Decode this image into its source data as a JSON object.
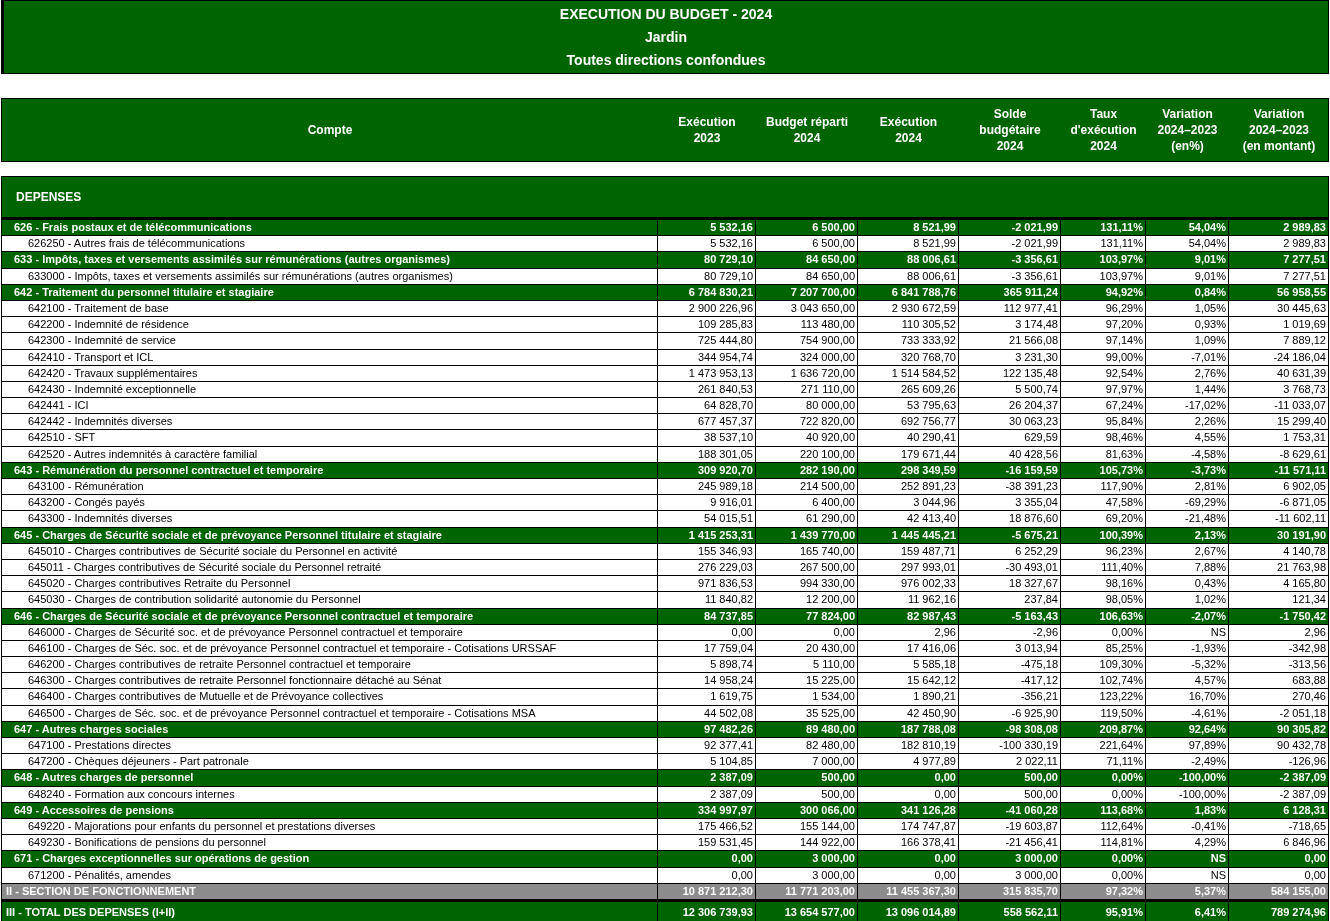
{
  "report": {
    "title": "EXECUTION DU BUDGET - 2024",
    "subtitle": "Jardin",
    "scope": "Toutes directions confondues"
  },
  "table": {
    "columns": [
      [
        "Compte"
      ],
      [
        "Exécution",
        "2023"
      ],
      [
        "Budget réparti",
        "2024"
      ],
      [
        "Exécution",
        "2024"
      ],
      [
        "Solde",
        "budgétaire",
        "2024"
      ],
      [
        "Taux",
        "d'exécution",
        "2024"
      ],
      [
        "Variation",
        "2024–2023",
        "(en%)"
      ],
      [
        "Variation",
        "2024–2023",
        "(en montant)"
      ]
    ],
    "section_title": "DEPENSES",
    "rows": [
      {
        "kind": "group",
        "label": "626 - Frais postaux et de télécommunications",
        "values": [
          "5 532,16",
          "6 500,00",
          "8 521,99",
          "-2 021,99",
          "131,11%",
          "54,04%",
          "2 989,83"
        ]
      },
      {
        "kind": "item",
        "label": "626250 - Autres frais de télécommunications",
        "values": [
          "5 532,16",
          "6 500,00",
          "8 521,99",
          "-2 021,99",
          "131,11%",
          "54,04%",
          "2 989,83"
        ]
      },
      {
        "kind": "group",
        "label": "633 - Impôts, taxes et versements assimilés sur rémunérations (autres organismes)",
        "values": [
          "80 729,10",
          "84 650,00",
          "88 006,61",
          "-3 356,61",
          "103,97%",
          "9,01%",
          "7 277,51"
        ]
      },
      {
        "kind": "item",
        "label": "633000 - Impôts, taxes et versements assimilés sur rémunérations (autres organismes)",
        "values": [
          "80 729,10",
          "84 650,00",
          "88 006,61",
          "-3 356,61",
          "103,97%",
          "9,01%",
          "7 277,51"
        ]
      },
      {
        "kind": "group",
        "label": "642 - Traitement du personnel titulaire et stagiaire",
        "values": [
          "6 784 830,21",
          "7 207 700,00",
          "6 841 788,76",
          "365 911,24",
          "94,92%",
          "0,84%",
          "56 958,55"
        ]
      },
      {
        "kind": "item",
        "label": "642100 - Traitement de base",
        "values": [
          "2 900 226,96",
          "3 043 650,00",
          "2 930 672,59",
          "112 977,41",
          "96,29%",
          "1,05%",
          "30 445,63"
        ]
      },
      {
        "kind": "item",
        "label": "642200 - Indemnité de résidence",
        "values": [
          "109 285,83",
          "113 480,00",
          "110 305,52",
          "3 174,48",
          "97,20%",
          "0,93%",
          "1 019,69"
        ]
      },
      {
        "kind": "item",
        "label": "642300 - Indemnité de service",
        "values": [
          "725 444,80",
          "754 900,00",
          "733 333,92",
          "21 566,08",
          "97,14%",
          "1,09%",
          "7 889,12"
        ]
      },
      {
        "kind": "item",
        "label": "642410 - Transport et ICL",
        "values": [
          "344 954,74",
          "324 000,00",
          "320 768,70",
          "3 231,30",
          "99,00%",
          "-7,01%",
          "-24 186,04"
        ]
      },
      {
        "kind": "item",
        "label": "642420 - Travaux supplémentaires",
        "values": [
          "1 473 953,13",
          "1 636 720,00",
          "1 514 584,52",
          "122 135,48",
          "92,54%",
          "2,76%",
          "40 631,39"
        ]
      },
      {
        "kind": "item",
        "label": "642430 - Indemnité exceptionnelle",
        "values": [
          "261 840,53",
          "271 110,00",
          "265 609,26",
          "5 500,74",
          "97,97%",
          "1,44%",
          "3 768,73"
        ]
      },
      {
        "kind": "item",
        "label": "642441 - ICI",
        "values": [
          "64 828,70",
          "80 000,00",
          "53 795,63",
          "26 204,37",
          "67,24%",
          "-17,02%",
          "-11 033,07"
        ]
      },
      {
        "kind": "item",
        "label": "642442 - Indemnités diverses",
        "values": [
          "677 457,37",
          "722 820,00",
          "692 756,77",
          "30 063,23",
          "95,84%",
          "2,26%",
          "15 299,40"
        ]
      },
      {
        "kind": "item",
        "label": "642510 - SFT",
        "values": [
          "38 537,10",
          "40 920,00",
          "40 290,41",
          "629,59",
          "98,46%",
          "4,55%",
          "1 753,31"
        ]
      },
      {
        "kind": "item",
        "label": "642520 - Autres indemnités à caractère familial",
        "values": [
          "188 301,05",
          "220 100,00",
          "179 671,44",
          "40 428,56",
          "81,63%",
          "-4,58%",
          "-8 629,61"
        ]
      },
      {
        "kind": "group",
        "label": "643 - Rémunération du personnel contractuel et temporaire",
        "values": [
          "309 920,70",
          "282 190,00",
          "298 349,59",
          "-16 159,59",
          "105,73%",
          "-3,73%",
          "-11 571,11"
        ]
      },
      {
        "kind": "item",
        "label": "643100 - Rémunération",
        "values": [
          "245 989,18",
          "214 500,00",
          "252 891,23",
          "-38 391,23",
          "117,90%",
          "2,81%",
          "6 902,05"
        ]
      },
      {
        "kind": "item",
        "label": "643200 - Congés payés",
        "values": [
          "9 916,01",
          "6 400,00",
          "3 044,96",
          "3 355,04",
          "47,58%",
          "-69,29%",
          "-6 871,05"
        ]
      },
      {
        "kind": "item",
        "label": "643300 - Indemnités diverses",
        "values": [
          "54 015,51",
          "61 290,00",
          "42 413,40",
          "18 876,60",
          "69,20%",
          "-21,48%",
          "-11 602,11"
        ]
      },
      {
        "kind": "group",
        "label": "645 - Charges de Sécurité sociale et de prévoyance Personnel titulaire et stagiaire",
        "values": [
          "1 415 253,31",
          "1 439 770,00",
          "1 445 445,21",
          "-5 675,21",
          "100,39%",
          "2,13%",
          "30 191,90"
        ]
      },
      {
        "kind": "item",
        "label": "645010 - Charges contributives de Sécurité sociale du Personnel en activité",
        "values": [
          "155 346,93",
          "165 740,00",
          "159 487,71",
          "6 252,29",
          "96,23%",
          "2,67%",
          "4 140,78"
        ]
      },
      {
        "kind": "item",
        "label": "645011 - Charges contributives de Sécurité sociale du Personnel retraité",
        "values": [
          "276 229,03",
          "267 500,00",
          "297 993,01",
          "-30 493,01",
          "111,40%",
          "7,88%",
          "21 763,98"
        ]
      },
      {
        "kind": "item",
        "label": "645020 - Charges contributives Retraite du Personnel",
        "values": [
          "971 836,53",
          "994 330,00",
          "976 002,33",
          "18 327,67",
          "98,16%",
          "0,43%",
          "4 165,80"
        ]
      },
      {
        "kind": "item",
        "label": "645030 - Charges de contribution solidarité autonomie du Personnel",
        "values": [
          "11 840,82",
          "12 200,00",
          "11 962,16",
          "237,84",
          "98,05%",
          "1,02%",
          "121,34"
        ]
      },
      {
        "kind": "group",
        "label": "646 - Charges de Sécurité sociale et de prévoyance Personnel contractuel et temporaire",
        "values": [
          "84 737,85",
          "77 824,00",
          "82 987,43",
          "-5 163,43",
          "106,63%",
          "-2,07%",
          "-1 750,42"
        ]
      },
      {
        "kind": "item",
        "label": "646000 - Charges de Sécurité soc. et de prévoyance Personnel contractuel et temporaire",
        "values": [
          "0,00",
          "0,00",
          "2,96",
          "-2,96",
          "0,00%",
          "NS",
          "2,96"
        ]
      },
      {
        "kind": "item",
        "label": "646100 - Charges de Séc. soc. et de prévoyance Personnel contractuel et temporaire - Cotisations URSSAF",
        "values": [
          "17 759,04",
          "20 430,00",
          "17 416,06",
          "3 013,94",
          "85,25%",
          "-1,93%",
          "-342,98"
        ]
      },
      {
        "kind": "item",
        "label": "646200 - Charges contributives de retraite Personnel contractuel et temporaire",
        "values": [
          "5 898,74",
          "5 110,00",
          "5 585,18",
          "-475,18",
          "109,30%",
          "-5,32%",
          "-313,56"
        ]
      },
      {
        "kind": "item",
        "label": "646300 - Charges contributives de retraite Personnel fonctionnaire détaché au Sénat",
        "values": [
          "14 958,24",
          "15 225,00",
          "15 642,12",
          "-417,12",
          "102,74%",
          "4,57%",
          "683,88"
        ]
      },
      {
        "kind": "item",
        "label": "646400 - Charges contributives de Mutuelle et de Prévoyance collectives",
        "values": [
          "1 619,75",
          "1 534,00",
          "1 890,21",
          "-356,21",
          "123,22%",
          "16,70%",
          "270,46"
        ]
      },
      {
        "kind": "item",
        "label": "646500 - Charges de Séc. soc. et de prévoyance Personnel contractuel et temporaire - Cotisations MSA",
        "values": [
          "44 502,08",
          "35 525,00",
          "42 450,90",
          "-6 925,90",
          "119,50%",
          "-4,61%",
          "-2 051,18"
        ]
      },
      {
        "kind": "group",
        "label": "647 - Autres charges sociales",
        "values": [
          "97 482,26",
          "89 480,00",
          "187 788,08",
          "-98 308,08",
          "209,87%",
          "92,64%",
          "90 305,82"
        ]
      },
      {
        "kind": "item",
        "label": "647100 - Prestations directes",
        "values": [
          "92 377,41",
          "82 480,00",
          "182 810,19",
          "-100 330,19",
          "221,64%",
          "97,89%",
          "90 432,78"
        ]
      },
      {
        "kind": "item",
        "label": "647200 - Chèques déjeuners - Part patronale",
        "values": [
          "5 104,85",
          "7 000,00",
          "4 977,89",
          "2 022,11",
          "71,11%",
          "-2,49%",
          "-126,96"
        ]
      },
      {
        "kind": "group",
        "label": "648 - Autres charges de personnel",
        "values": [
          "2 387,09",
          "500,00",
          "0,00",
          "500,00",
          "0,00%",
          "-100,00%",
          "-2 387,09"
        ]
      },
      {
        "kind": "item",
        "label": "648240 - Formation aux concours internes",
        "values": [
          "2 387,09",
          "500,00",
          "0,00",
          "500,00",
          "0,00%",
          "-100,00%",
          "-2 387,09"
        ]
      },
      {
        "kind": "group",
        "label": "649 - Accessoires de pensions",
        "values": [
          "334 997,97",
          "300 066,00",
          "341 126,28",
          "-41 060,28",
          "113,68%",
          "1,83%",
          "6 128,31"
        ]
      },
      {
        "kind": "item",
        "label": "649220 - Majorations pour enfants du personnel et prestations diverses",
        "values": [
          "175 466,52",
          "155 144,00",
          "174 747,87",
          "-19 603,87",
          "112,64%",
          "-0,41%",
          "-718,65"
        ]
      },
      {
        "kind": "item",
        "label": "649230 - Bonifications de pensions du personnel",
        "values": [
          "159 531,45",
          "144 922,00",
          "166 378,41",
          "-21 456,41",
          "114,81%",
          "4,29%",
          "6 846,96"
        ]
      },
      {
        "kind": "group",
        "label": "671 - Charges exceptionnelles sur opérations de gestion",
        "values": [
          "0,00",
          "3 000,00",
          "0,00",
          "3 000,00",
          "0,00%",
          "NS",
          "0,00"
        ]
      },
      {
        "kind": "item",
        "label": "671200 - Pénalités, amendes",
        "values": [
          "0,00",
          "3 000,00",
          "0,00",
          "3 000,00",
          "0,00%",
          "NS",
          "0,00"
        ]
      },
      {
        "kind": "section",
        "label": "II - SECTION DE FONCTIONNEMENT",
        "values": [
          "10 871 212,30",
          "11 771 203,00",
          "11 455 367,30",
          "315 835,70",
          "97,32%",
          "5,37%",
          "584 155,00"
        ]
      },
      {
        "kind": "total",
        "label": "III - TOTAL DES DEPENSES (I+II)",
        "values": [
          "12 306 739,93",
          "13 654 577,00",
          "13 096 014,89",
          "558 562,11",
          "95,91%",
          "6,41%",
          "789 274,96"
        ]
      }
    ]
  }
}
